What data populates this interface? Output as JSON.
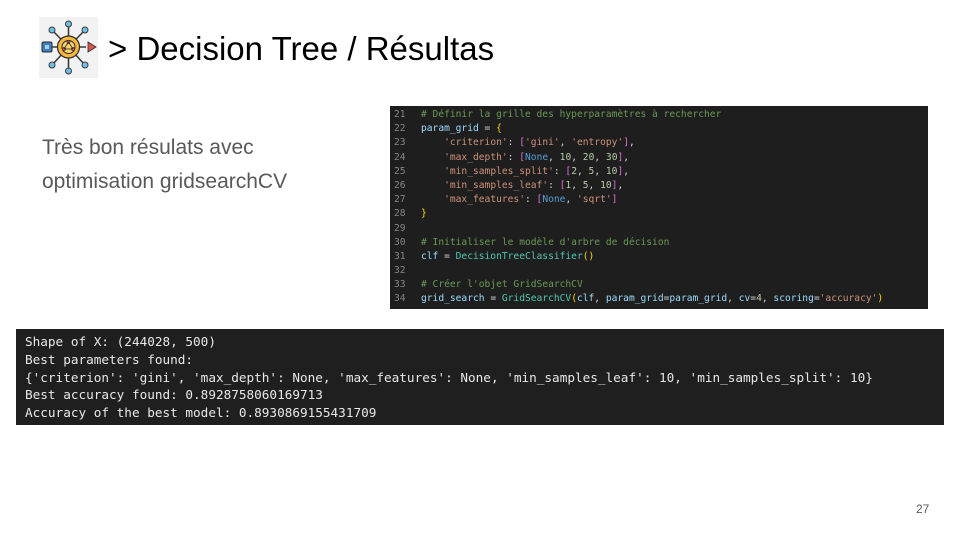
{
  "slide": {
    "title": "> Decision Tree / Résultas",
    "body_lines": [
      "Très bon résulats avec",
      "optimisation gridsearchCV"
    ],
    "page_number": "27",
    "logo_icon": "neural-network-chip-icon"
  },
  "code": {
    "lines": [
      {
        "n": "21",
        "tokens": [
          {
            "t": "# Définir la grille des hyperparamètres à rechercher",
            "c": "com"
          }
        ]
      },
      {
        "n": "22",
        "tokens": [
          {
            "t": "param_grid",
            "c": "var"
          },
          {
            "t": " = ",
            "c": "op"
          },
          {
            "t": "{",
            "c": "br1"
          }
        ]
      },
      {
        "n": "23",
        "tokens": [
          {
            "t": "    ",
            "c": "op"
          },
          {
            "t": "'criterion'",
            "c": "str"
          },
          {
            "t": ": ",
            "c": "op"
          },
          {
            "t": "[",
            "c": "br2"
          },
          {
            "t": "'gini'",
            "c": "str"
          },
          {
            "t": ", ",
            "c": "op"
          },
          {
            "t": "'entropy'",
            "c": "str"
          },
          {
            "t": "]",
            "c": "br2"
          },
          {
            "t": ",",
            "c": "op"
          }
        ]
      },
      {
        "n": "24",
        "tokens": [
          {
            "t": "    ",
            "c": "op"
          },
          {
            "t": "'max_depth'",
            "c": "str"
          },
          {
            "t": ": ",
            "c": "op"
          },
          {
            "t": "[",
            "c": "br2"
          },
          {
            "t": "None",
            "c": "kw"
          },
          {
            "t": ", ",
            "c": "op"
          },
          {
            "t": "10",
            "c": "num"
          },
          {
            "t": ", ",
            "c": "op"
          },
          {
            "t": "20",
            "c": "num"
          },
          {
            "t": ", ",
            "c": "op"
          },
          {
            "t": "30",
            "c": "num"
          },
          {
            "t": "]",
            "c": "br2"
          },
          {
            "t": ",",
            "c": "op"
          }
        ]
      },
      {
        "n": "25",
        "tokens": [
          {
            "t": "    ",
            "c": "op"
          },
          {
            "t": "'min_samples_split'",
            "c": "str"
          },
          {
            "t": ": ",
            "c": "op"
          },
          {
            "t": "[",
            "c": "br2"
          },
          {
            "t": "2",
            "c": "num"
          },
          {
            "t": ", ",
            "c": "op"
          },
          {
            "t": "5",
            "c": "num"
          },
          {
            "t": ", ",
            "c": "op"
          },
          {
            "t": "10",
            "c": "num"
          },
          {
            "t": "]",
            "c": "br2"
          },
          {
            "t": ",",
            "c": "op"
          }
        ]
      },
      {
        "n": "26",
        "tokens": [
          {
            "t": "    ",
            "c": "op"
          },
          {
            "t": "'min_samples_leaf'",
            "c": "str"
          },
          {
            "t": ": ",
            "c": "op"
          },
          {
            "t": "[",
            "c": "br2"
          },
          {
            "t": "1",
            "c": "num"
          },
          {
            "t": ", ",
            "c": "op"
          },
          {
            "t": "5",
            "c": "num"
          },
          {
            "t": ", ",
            "c": "op"
          },
          {
            "t": "10",
            "c": "num"
          },
          {
            "t": "]",
            "c": "br2"
          },
          {
            "t": ",",
            "c": "op"
          }
        ]
      },
      {
        "n": "27",
        "tokens": [
          {
            "t": "    ",
            "c": "op"
          },
          {
            "t": "'max_features'",
            "c": "str"
          },
          {
            "t": ": ",
            "c": "op"
          },
          {
            "t": "[",
            "c": "br2"
          },
          {
            "t": "None",
            "c": "kw"
          },
          {
            "t": ", ",
            "c": "op"
          },
          {
            "t": "'sqrt'",
            "c": "str"
          },
          {
            "t": "]",
            "c": "br2"
          }
        ]
      },
      {
        "n": "28",
        "tokens": [
          {
            "t": "}",
            "c": "br1"
          }
        ]
      },
      {
        "n": "29",
        "tokens": []
      },
      {
        "n": "30",
        "tokens": [
          {
            "t": "# Initialiser le modèle d'arbre de décision",
            "c": "com"
          }
        ]
      },
      {
        "n": "31",
        "tokens": [
          {
            "t": "clf",
            "c": "var"
          },
          {
            "t": " = ",
            "c": "op"
          },
          {
            "t": "DecisionTreeClassifier",
            "c": "cls"
          },
          {
            "t": "()",
            "c": "br1"
          }
        ]
      },
      {
        "n": "32",
        "tokens": []
      },
      {
        "n": "33",
        "tokens": [
          {
            "t": "# Créer l'objet GridSearchCV",
            "c": "com"
          }
        ]
      },
      {
        "n": "34",
        "tokens": [
          {
            "t": "grid_search",
            "c": "var"
          },
          {
            "t": " = ",
            "c": "op"
          },
          {
            "t": "GridSearchCV",
            "c": "cls"
          },
          {
            "t": "(",
            "c": "br1"
          },
          {
            "t": "clf",
            "c": "var"
          },
          {
            "t": ", ",
            "c": "op"
          },
          {
            "t": "param_grid",
            "c": "var"
          },
          {
            "t": "=",
            "c": "op"
          },
          {
            "t": "param_grid",
            "c": "var"
          },
          {
            "t": ", ",
            "c": "op"
          },
          {
            "t": "cv",
            "c": "var"
          },
          {
            "t": "=",
            "c": "op"
          },
          {
            "t": "4",
            "c": "num"
          },
          {
            "t": ", ",
            "c": "op"
          },
          {
            "t": "scoring",
            "c": "var"
          },
          {
            "t": "=",
            "c": "op"
          },
          {
            "t": "'accuracy'",
            "c": "str"
          },
          {
            "t": ")",
            "c": "br1"
          }
        ]
      }
    ]
  },
  "output": {
    "lines": [
      "Shape of X: (244028, 500)",
      "Best parameters found:",
      "{'criterion': 'gini', 'max_depth': None, 'max_features': None, 'min_samples_leaf': 10, 'min_samples_split': 10}",
      "Best accuracy found: 0.8928758060169713",
      "Accuracy of the best model: 0.8930869155431709"
    ]
  }
}
